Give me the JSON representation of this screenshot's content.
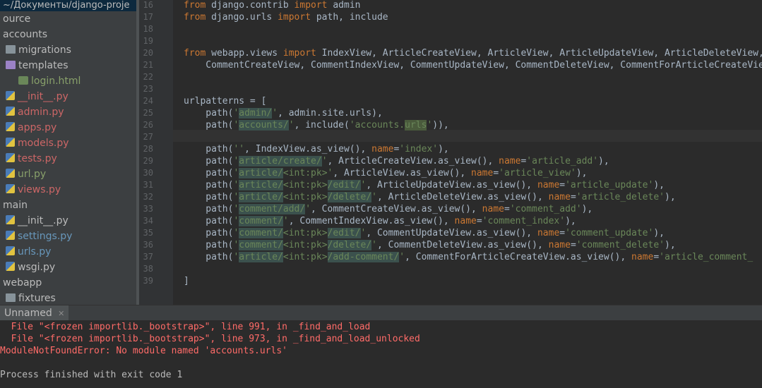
{
  "sidebar": {
    "path": "~/Документы/django-proje",
    "items": [
      {
        "label": "ource",
        "icon": "none",
        "color": "white"
      },
      {
        "label": "accounts",
        "icon": "none",
        "color": "white"
      },
      {
        "label": "migrations",
        "icon": "folder-icon",
        "color": "white"
      },
      {
        "label": "templates",
        "icon": "folder-icon",
        "color": "white"
      },
      {
        "label": "login.html",
        "icon": "html-file-icon",
        "color": "green"
      },
      {
        "label": "__init__.py",
        "icon": "python-file-icon",
        "color": "red"
      },
      {
        "label": "admin.py",
        "icon": "python-file-icon",
        "color": "red"
      },
      {
        "label": "apps.py",
        "icon": "python-file-icon",
        "color": "red"
      },
      {
        "label": "models.py",
        "icon": "python-file-icon",
        "color": "red"
      },
      {
        "label": "tests.py",
        "icon": "python-file-icon",
        "color": "red"
      },
      {
        "label": "url.py",
        "icon": "python-file-icon",
        "color": "green"
      },
      {
        "label": "views.py",
        "icon": "python-file-icon",
        "color": "red"
      },
      {
        "label": "main",
        "icon": "none",
        "color": "white"
      },
      {
        "label": "__init__.py",
        "icon": "python-file-icon",
        "color": "white"
      },
      {
        "label": "settings.py",
        "icon": "python-file-icon",
        "color": "blue"
      },
      {
        "label": "urls.py",
        "icon": "python-file-icon",
        "color": "blue"
      },
      {
        "label": "wsgi.py",
        "icon": "python-file-icon",
        "color": "white"
      },
      {
        "label": "webapp",
        "icon": "none",
        "color": "white"
      },
      {
        "label": "fixtures",
        "icon": "folder-icon",
        "color": "white"
      }
    ]
  },
  "editor": {
    "line_numbers": [
      "16",
      "17",
      "18",
      "19",
      "20",
      "21",
      "22",
      "23",
      "24",
      "25",
      "26",
      "27",
      "28",
      "29",
      "30",
      "31",
      "32",
      "33",
      "34",
      "35",
      "36",
      "37",
      "38",
      "39"
    ],
    "lines": [
      {
        "n": "16",
        "parts": [
          [
            "kw",
            "from"
          ],
          [
            "t",
            " django.contrib "
          ],
          [
            "kw",
            "import"
          ],
          [
            "t",
            " admin"
          ]
        ]
      },
      {
        "n": "17",
        "parts": [
          [
            "kw",
            "from"
          ],
          [
            "t",
            " django.urls "
          ],
          [
            "kw",
            "import"
          ],
          [
            "t",
            " path, include"
          ]
        ]
      },
      {
        "n": "18",
        "parts": []
      },
      {
        "n": "19",
        "parts": []
      },
      {
        "n": "20",
        "parts": [
          [
            "kw",
            "from"
          ],
          [
            "t",
            " webapp.views "
          ],
          [
            "kw",
            "import"
          ],
          [
            "t",
            " IndexView, ArticleCreateView, ArticleView, ArticleUpdateView, ArticleDeleteView,"
          ]
        ]
      },
      {
        "n": "21",
        "parts": [
          [
            "t",
            "    CommentCreateView, CommentIndexView, CommentUpdateView, CommentDeleteView, CommentForArticleCreateView"
          ]
        ]
      },
      {
        "n": "22",
        "parts": []
      },
      {
        "n": "23",
        "parts": []
      },
      {
        "n": "24",
        "parts": [
          [
            "t",
            "urlpatterns = ["
          ]
        ]
      },
      {
        "n": "25",
        "parts": [
          [
            "t",
            "    path("
          ],
          [
            "st",
            "'"
          ],
          [
            "sth",
            "admin/"
          ],
          [
            "st",
            "'"
          ],
          [
            "t",
            ", admin.site.urls),"
          ]
        ]
      },
      {
        "n": "26",
        "parts": [
          [
            "t",
            "    path("
          ],
          [
            "st",
            "'"
          ],
          [
            "sth",
            "accounts/"
          ],
          [
            "st",
            "'"
          ],
          [
            "t",
            ", include("
          ],
          [
            "st",
            "'accounts."
          ],
          [
            "stu",
            "urls"
          ],
          [
            "st",
            "'"
          ],
          [
            "t",
            ")),"
          ]
        ]
      },
      {
        "n": "27",
        "parts": []
      },
      {
        "n": "28",
        "parts": [
          [
            "t",
            "    path("
          ],
          [
            "st",
            "''"
          ],
          [
            "t",
            ", IndexView.as_view(), "
          ],
          [
            "kw",
            "name"
          ],
          [
            "t",
            "="
          ],
          [
            "st",
            "'index'"
          ],
          [
            "t",
            "),"
          ]
        ]
      },
      {
        "n": "29",
        "parts": [
          [
            "t",
            "    path("
          ],
          [
            "st",
            "'"
          ],
          [
            "sth",
            "article/create/"
          ],
          [
            "st",
            "'"
          ],
          [
            "t",
            ", ArticleCreateView.as_view(), "
          ],
          [
            "kw",
            "name"
          ],
          [
            "t",
            "="
          ],
          [
            "st",
            "'article_add'"
          ],
          [
            "t",
            "),"
          ]
        ]
      },
      {
        "n": "30",
        "parts": [
          [
            "t",
            "    path("
          ],
          [
            "st",
            "'"
          ],
          [
            "sth",
            "article/"
          ],
          [
            "st",
            "<int:pk>'"
          ],
          [
            "t",
            ", ArticleView.as_view(), "
          ],
          [
            "kw",
            "name"
          ],
          [
            "t",
            "="
          ],
          [
            "st",
            "'article_view'"
          ],
          [
            "t",
            "),"
          ]
        ]
      },
      {
        "n": "31",
        "parts": [
          [
            "t",
            "    path("
          ],
          [
            "st",
            "'"
          ],
          [
            "sth",
            "article/"
          ],
          [
            "st",
            "<int:pk>"
          ],
          [
            "sth",
            "/edit/"
          ],
          [
            "st",
            "'"
          ],
          [
            "t",
            ", ArticleUpdateView.as_view(), "
          ],
          [
            "kw",
            "name"
          ],
          [
            "t",
            "="
          ],
          [
            "st",
            "'article_update'"
          ],
          [
            "t",
            "),"
          ]
        ]
      },
      {
        "n": "32",
        "parts": [
          [
            "t",
            "    path("
          ],
          [
            "st",
            "'"
          ],
          [
            "sth",
            "article/"
          ],
          [
            "st",
            "<int:pk>"
          ],
          [
            "sth",
            "/delete/"
          ],
          [
            "st",
            "'"
          ],
          [
            "t",
            ", ArticleDeleteView.as_view(), "
          ],
          [
            "kw",
            "name"
          ],
          [
            "t",
            "="
          ],
          [
            "st",
            "'article_delete'"
          ],
          [
            "t",
            "),"
          ]
        ]
      },
      {
        "n": "33",
        "parts": [
          [
            "t",
            "    path("
          ],
          [
            "st",
            "'"
          ],
          [
            "sth",
            "comment/add/"
          ],
          [
            "st",
            "'"
          ],
          [
            "t",
            ", CommentCreateView.as_view(), "
          ],
          [
            "kw",
            "name"
          ],
          [
            "t",
            "="
          ],
          [
            "st",
            "'comment_add'"
          ],
          [
            "t",
            "),"
          ]
        ]
      },
      {
        "n": "34",
        "parts": [
          [
            "t",
            "    path("
          ],
          [
            "st",
            "'"
          ],
          [
            "sth",
            "comment/"
          ],
          [
            "st",
            "'"
          ],
          [
            "t",
            ", CommentIndexView.as_view(), "
          ],
          [
            "kw",
            "name"
          ],
          [
            "t",
            "="
          ],
          [
            "st",
            "'comment_index'"
          ],
          [
            "t",
            "),"
          ]
        ]
      },
      {
        "n": "35",
        "parts": [
          [
            "t",
            "    path("
          ],
          [
            "st",
            "'"
          ],
          [
            "sth",
            "comment/"
          ],
          [
            "st",
            "<int:pk>"
          ],
          [
            "sth",
            "/edit/"
          ],
          [
            "st",
            "'"
          ],
          [
            "t",
            ", CommentUpdateView.as_view(), "
          ],
          [
            "kw",
            "name"
          ],
          [
            "t",
            "="
          ],
          [
            "st",
            "'comment_update'"
          ],
          [
            "t",
            "),"
          ]
        ]
      },
      {
        "n": "36",
        "parts": [
          [
            "t",
            "    path("
          ],
          [
            "st",
            "'"
          ],
          [
            "sth",
            "comment/"
          ],
          [
            "st",
            "<int:pk>"
          ],
          [
            "sth",
            "/delete/"
          ],
          [
            "st",
            "'"
          ],
          [
            "t",
            ", CommentDeleteView.as_view(), "
          ],
          [
            "kw",
            "name"
          ],
          [
            "t",
            "="
          ],
          [
            "st",
            "'comment_delete'"
          ],
          [
            "t",
            "),"
          ]
        ]
      },
      {
        "n": "37",
        "parts": [
          [
            "t",
            "    path("
          ],
          [
            "st",
            "'"
          ],
          [
            "sth",
            "article/"
          ],
          [
            "st",
            "<int:pk>"
          ],
          [
            "sth",
            "/add-comment/"
          ],
          [
            "st",
            "'"
          ],
          [
            "t",
            ", CommentForArticleCreateView.as_view(), "
          ],
          [
            "kw",
            "name"
          ],
          [
            "t",
            "="
          ],
          [
            "st",
            "'article_comment_"
          ]
        ]
      },
      {
        "n": "38",
        "parts": []
      },
      {
        "n": "39",
        "parts": [
          [
            "t",
            "]"
          ]
        ]
      }
    ]
  },
  "run_panel": {
    "tab_label": "Unnamed",
    "close_glyph": "✕",
    "output": [
      {
        "text": "  File \"<frozen importlib._bootstrap>\", line 991, in _find_and_load",
        "kind": "err"
      },
      {
        "text": "  File \"<frozen importlib._bootstrap>\", line 973, in _find_and_load_unlocked",
        "kind": "err"
      },
      {
        "text": "ModuleNotFoundError: No module named 'accounts.urls'",
        "kind": "err"
      },
      {
        "text": "",
        "kind": "ok"
      },
      {
        "text": "Process finished with exit code 1",
        "kind": "ok"
      }
    ]
  },
  "colors": {
    "keyword": "#cc7832",
    "string": "#6a8759",
    "default_text": "#a9b7c6",
    "error": "#ff6b68"
  }
}
